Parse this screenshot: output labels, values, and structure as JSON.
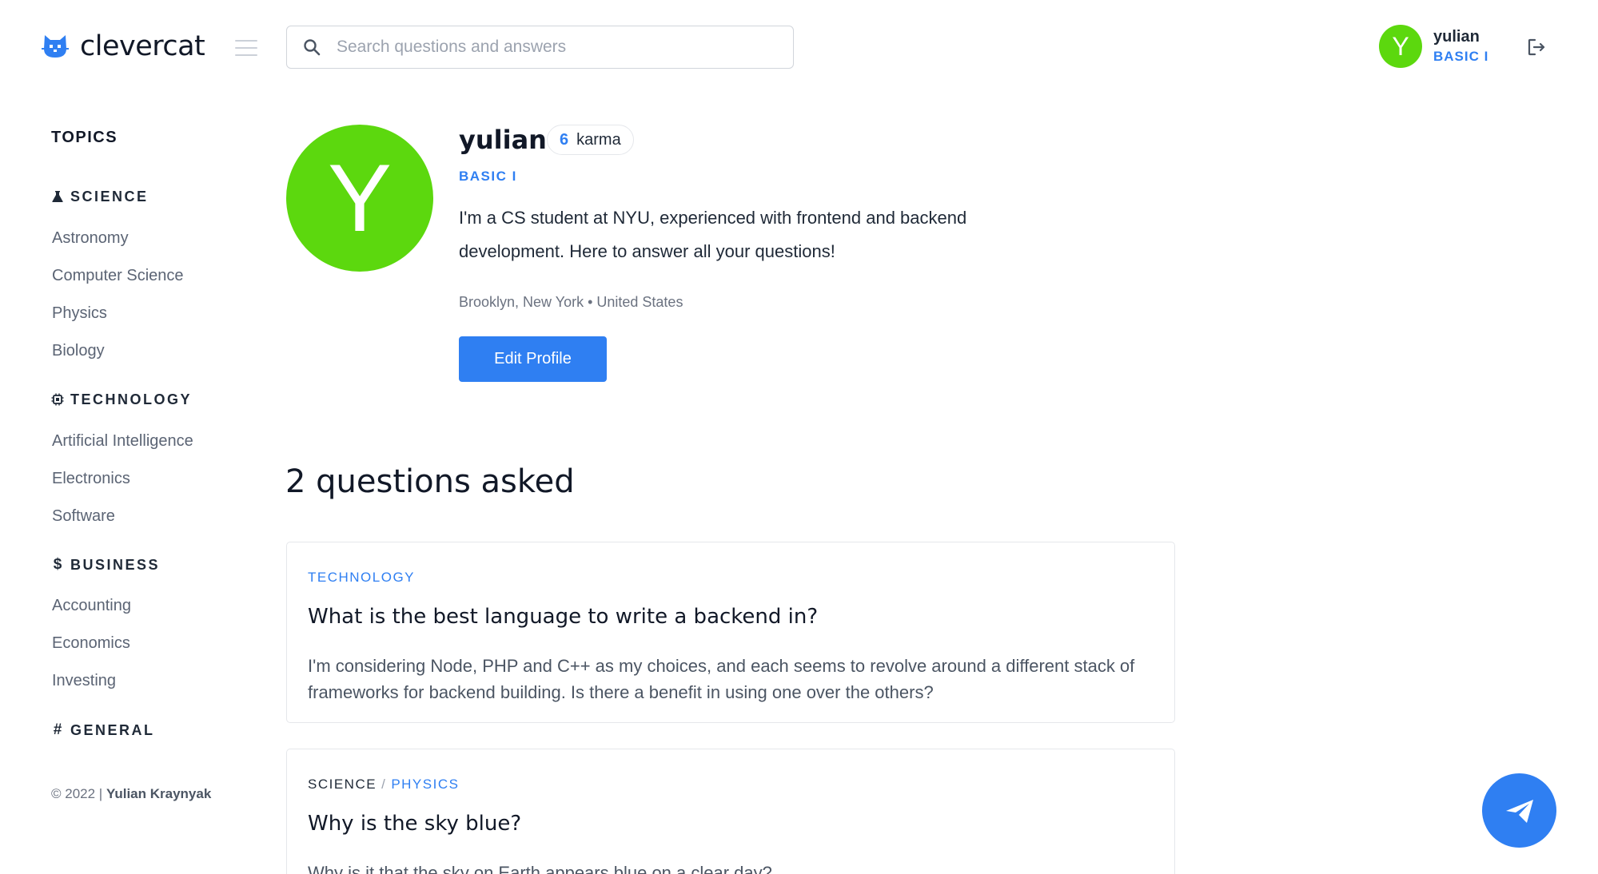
{
  "brand": {
    "name": "clevercat"
  },
  "search": {
    "placeholder": "Search questions and answers"
  },
  "user": {
    "initial": "Y",
    "name": "yulian",
    "level": "BASIC I"
  },
  "sidebar": {
    "title": "TOPICS",
    "categories": [
      {
        "name": "SCIENCE",
        "icon": "flask-icon",
        "items": [
          "Astronomy",
          "Computer Science",
          "Physics",
          "Biology"
        ]
      },
      {
        "name": "TECHNOLOGY",
        "icon": "chip-icon",
        "items": [
          "Artificial Intelligence",
          "Electronics",
          "Software"
        ]
      },
      {
        "name": "BUSINESS",
        "icon": "dollar-icon",
        "items": [
          "Accounting",
          "Economics",
          "Investing"
        ]
      },
      {
        "name": "GENERAL",
        "icon": "hash-icon",
        "items": []
      }
    ],
    "copyright_prefix": "© 2022 | ",
    "copyright_author": "Yulian Kraynyak"
  },
  "profile": {
    "initial": "Y",
    "name": "yulian",
    "karma_value": "6",
    "karma_label": "karma",
    "level": "BASIC I",
    "bio": "I'm a CS student at NYU, experienced with frontend and backend development. Here to answer all your questions!",
    "location": "Brooklyn, New York • United States",
    "edit_label": "Edit Profile"
  },
  "questions": {
    "heading": "2 questions asked",
    "items": [
      {
        "category": "TECHNOLOGY",
        "subcategory": "",
        "title": "What is the best language to write a backend in?",
        "body": "I'm considering Node, PHP and C++ as my choices, and each seems to revolve around a different stack of frameworks for backend building. Is there a benefit in using one over the others?"
      },
      {
        "category": "SCIENCE",
        "separator": "/",
        "subcategory": "PHYSICS",
        "title": "Why is the sky blue?",
        "body": "Why is it that the sky on Earth appears blue on a clear day?"
      }
    ]
  },
  "colors": {
    "accent": "#2f7ff2",
    "avatar": "#5cd80e"
  },
  "icons": {
    "logo": "cat-logo-icon",
    "menu": "hamburger-icon",
    "search": "search-icon",
    "logout": "logout-icon",
    "fab": "send-icon"
  }
}
